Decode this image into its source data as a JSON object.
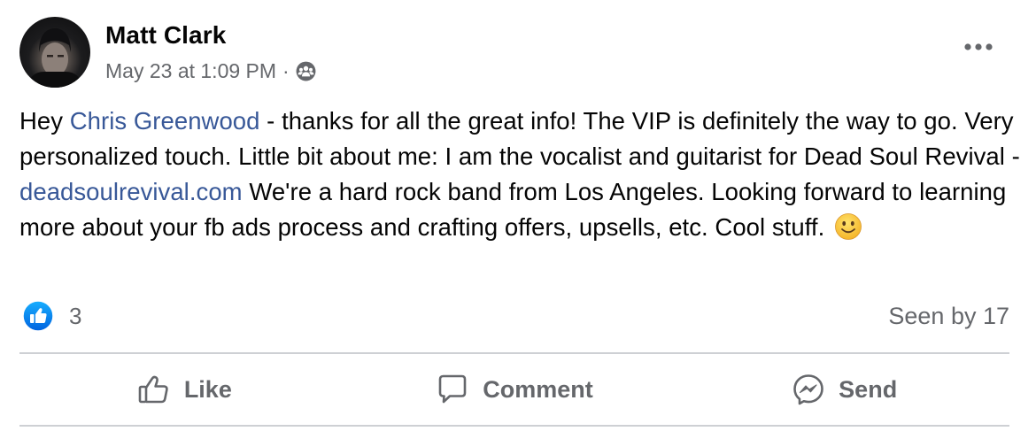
{
  "post": {
    "author": "Matt Clark",
    "timestamp": "May 23 at 1:09 PM",
    "separator": "·",
    "audience_icon": "group-audience-icon",
    "more_icon": "more-options-icon",
    "body": {
      "greeting": "Hey ",
      "mention": "Chris Greenwood",
      "text_1": " - thanks for all the great info!  The VIP is definitely the way to go. Very personalized touch.  Little bit about me:  I am the vocalist and guitarist for Dead Soul Revival - ",
      "link": "deadsoulrevival.com",
      "text_2": "   We're a hard rock band from Los Angeles. Looking forward to learning more about your fb ads process and crafting offers, upsells, etc.  Cool stuff. ",
      "emoji": "slightly-smiling-face"
    },
    "reactions": {
      "icon": "like-reaction-icon",
      "count": "3"
    },
    "seen_by": "Seen by 17",
    "actions": [
      {
        "label": "Like",
        "icon": "thumbs-up-icon"
      },
      {
        "label": "Comment",
        "icon": "comment-bubble-icon"
      },
      {
        "label": "Send",
        "icon": "messenger-icon"
      }
    ]
  },
  "colors": {
    "text": "#050505",
    "secondary": "#65676b",
    "link": "#385898",
    "like_blue": "#1b74e4",
    "divider": "#ced0d4"
  }
}
